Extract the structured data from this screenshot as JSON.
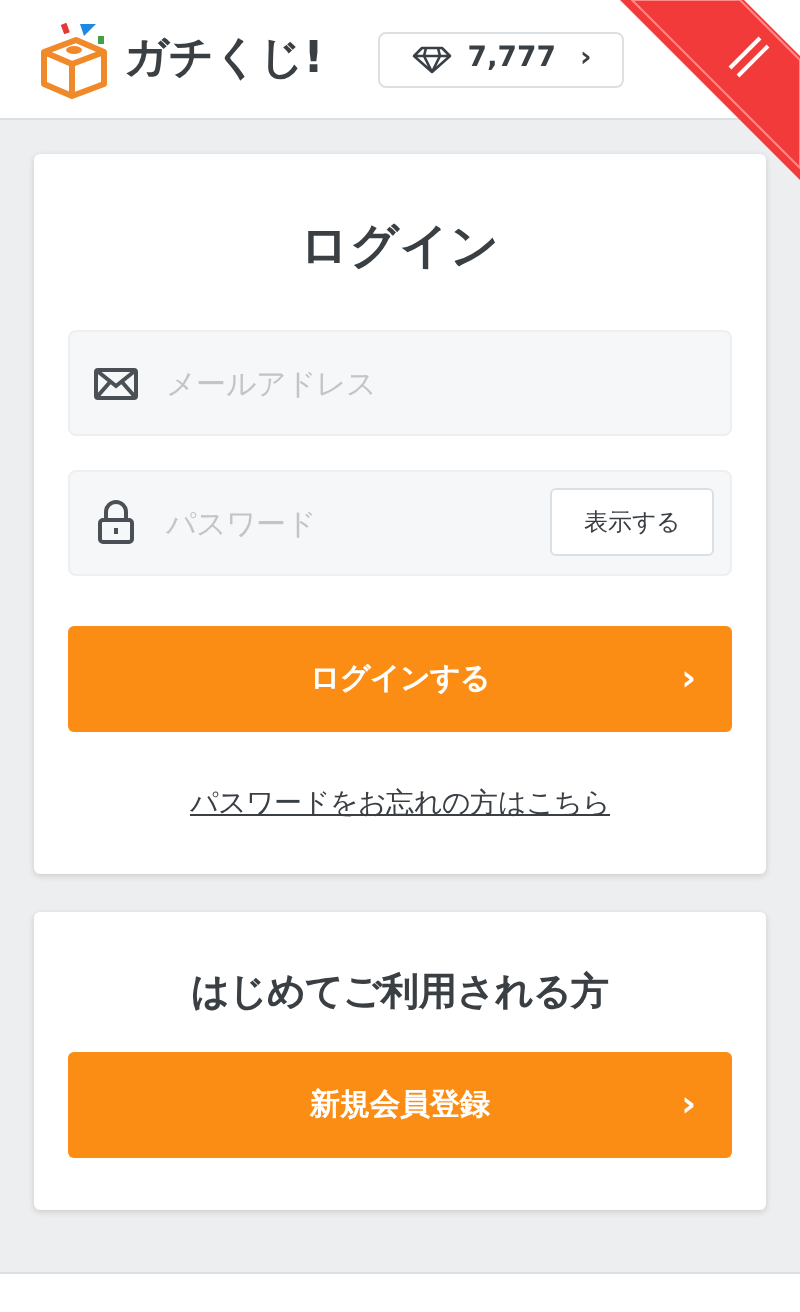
{
  "header": {
    "logo_text": "ガチくじ!",
    "gems": "7,777",
    "chevron": "›"
  },
  "login": {
    "title": "ログイン",
    "email": {
      "placeholder": "メールアドレス"
    },
    "password": {
      "placeholder": "パスワード",
      "show_button": "表示する"
    },
    "submit": "ログインする",
    "submit_chevron": "›",
    "forgot_link": "パスワードをお忘れの方はこちら"
  },
  "signup": {
    "title": "はじめてご利用される方",
    "button": "新規会員登録",
    "button_chevron": "›"
  }
}
